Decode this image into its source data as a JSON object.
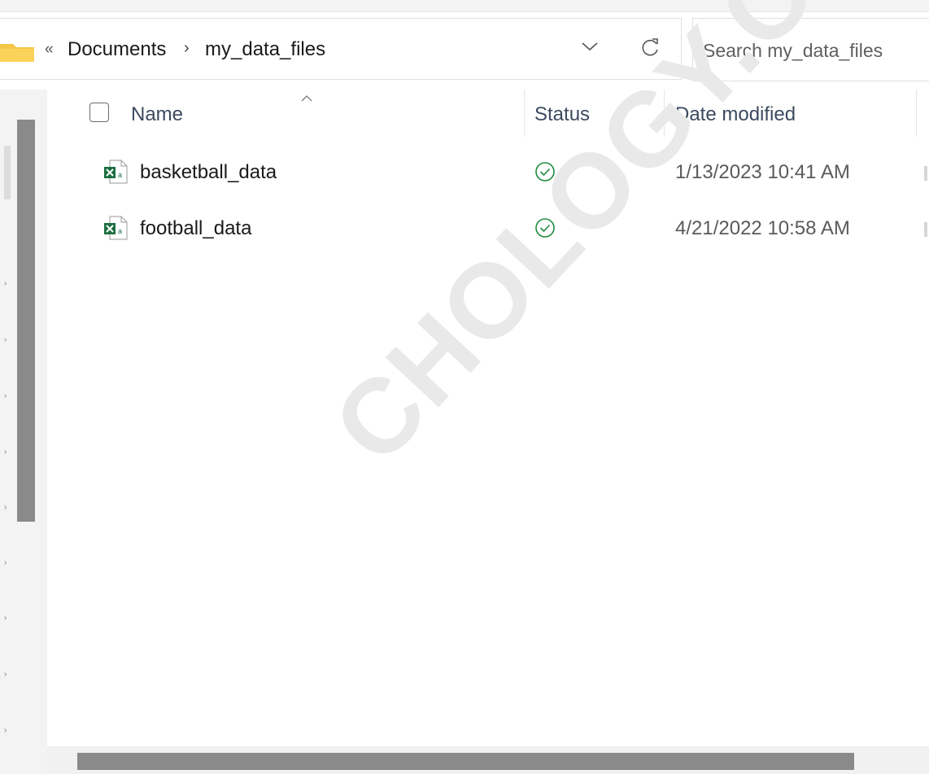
{
  "address": {
    "back_glyph": "«",
    "separator": "›",
    "breadcrumbs": [
      "Documents",
      "my_data_files"
    ]
  },
  "search": {
    "placeholder": "Search my_data_files"
  },
  "columns": {
    "name": "Name",
    "status": "Status",
    "date_modified": "Date modified"
  },
  "files": [
    {
      "name": "basketball_data",
      "date": "1/13/2023 10:41 AM",
      "status_icon": "synced-check-icon",
      "file_icon": "excel-icon"
    },
    {
      "name": "football_data",
      "date": "4/21/2022 10:58 AM",
      "status_icon": "synced-check-icon",
      "file_icon": "excel-icon"
    }
  ],
  "watermark": "CHOLOGY.COM",
  "colors": {
    "status_ok": "#1e8a3c",
    "excel_green": "#1d6f42",
    "folder_yellow": "#f6c646",
    "header_text": "#3c4a5e"
  }
}
